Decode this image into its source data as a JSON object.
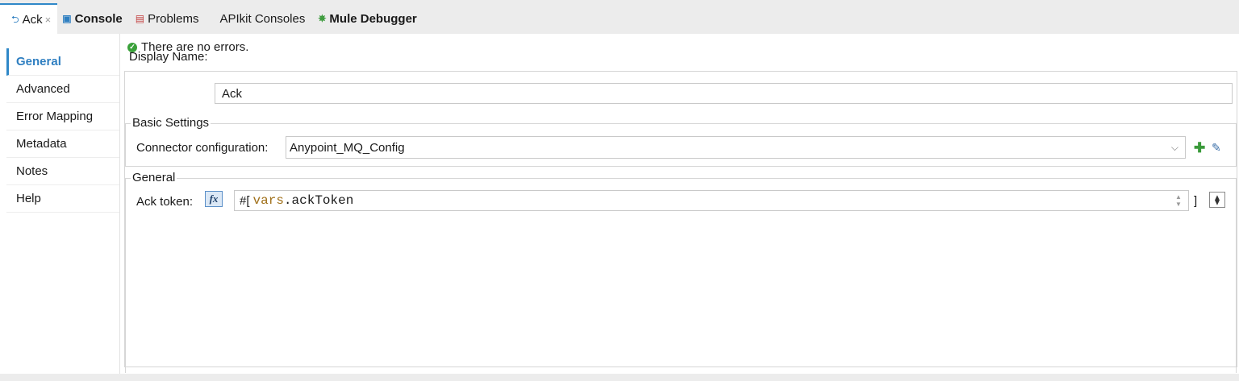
{
  "tabs": [
    {
      "label": "Ack",
      "icon": "mule-component-icon",
      "active": true,
      "closable": true
    },
    {
      "label": "Console",
      "icon": "console-icon",
      "active": false,
      "bold": true
    },
    {
      "label": "Problems",
      "icon": "problems-icon",
      "active": false
    },
    {
      "label": "APIkit Consoles",
      "icon": "",
      "active": false
    },
    {
      "label": "Mule Debugger",
      "icon": "debugger-icon",
      "active": false,
      "bold": true
    }
  ],
  "nav": {
    "items": [
      {
        "label": "General",
        "active": true
      },
      {
        "label": "Advanced"
      },
      {
        "label": "Error Mapping"
      },
      {
        "label": "Metadata"
      },
      {
        "label": "Notes"
      },
      {
        "label": "Help"
      }
    ]
  },
  "status": {
    "text": "There are no errors.",
    "icon": "check-circle-icon",
    "color": "#3aa13a"
  },
  "display_name": {
    "label": "Display Name:",
    "value": "Ack"
  },
  "basic_settings": {
    "title": "Basic Settings",
    "connector_label": "Connector configuration:",
    "connector_value": "Anypoint_MQ_Config"
  },
  "general": {
    "title": "General",
    "ack_token_label": "Ack token:",
    "fx_label": "fx",
    "expr_prefix": "#[",
    "expr_var": "vars",
    "expr_rest": ".ackToken",
    "expr_suffix": "]"
  },
  "colors": {
    "accent": "#2f88c8",
    "expr_keyword": "#a0701a"
  }
}
